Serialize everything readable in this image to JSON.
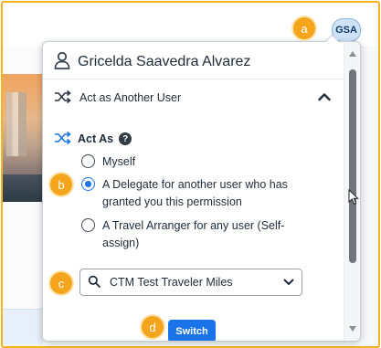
{
  "header": {
    "avatar_initials": "GSA"
  },
  "callouts": {
    "a": "a",
    "b": "b",
    "c": "c",
    "d": "d"
  },
  "profile_menu": {
    "user_name": "Gricelda Saavedra Alvarez",
    "act_as_another_user_label": "Act as Another User",
    "act_as_label": "Act As",
    "help_symbol": "?",
    "options": [
      {
        "label": "Myself",
        "selected": false
      },
      {
        "label": "A Delegate for another user who has granted you this permission",
        "selected": true
      },
      {
        "label": "A Travel Arranger for any user (Self-assign)",
        "selected": false
      }
    ],
    "user_select_value": "CTM Test Traveler Miles",
    "switch_button_label": "Switch"
  },
  "colors": {
    "accent": "#1a73e8",
    "callout": "#f4a51c",
    "frame": "#f5b31e"
  },
  "icons": {
    "user": "user-outline-icon",
    "shuffle": "shuffle-icon",
    "chevron_up": "chevron-up-icon",
    "help": "help-icon",
    "search": "search-icon",
    "chevron_down": "chevron-down-icon"
  }
}
